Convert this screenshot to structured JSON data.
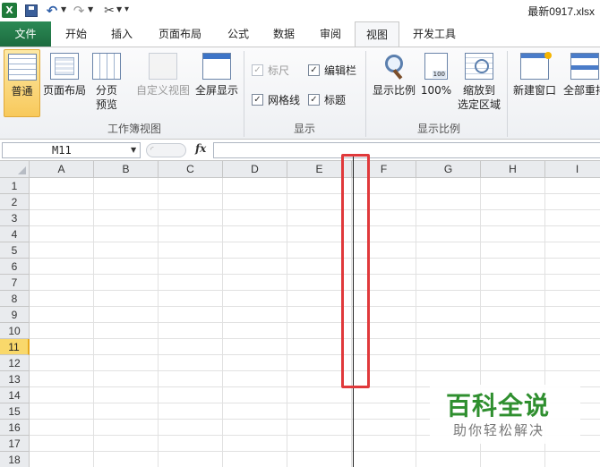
{
  "window": {
    "title": "最新0917.xlsx",
    "app_logo": "X"
  },
  "quick_access": {
    "icons": [
      "excel-logo-icon",
      "save-icon",
      "undo-icon",
      "redo-icon",
      "tools-icon"
    ]
  },
  "tabs": [
    {
      "label": "文件"
    },
    {
      "label": "开始"
    },
    {
      "label": "插入"
    },
    {
      "label": "页面布局"
    },
    {
      "label": "公式"
    },
    {
      "label": "数据"
    },
    {
      "label": "审阅"
    },
    {
      "label": "视图"
    },
    {
      "label": "开发工具"
    }
  ],
  "active_tab": "视图",
  "ribbon": {
    "workbook_views": {
      "label": "工作簿视图",
      "normal": "普通",
      "page_layout": "页面布局",
      "page_break_1": "分页",
      "page_break_2": "预览",
      "custom_views": "自定义视图",
      "full_screen": "全屏显示"
    },
    "show": {
      "label": "显示",
      "ruler": "标尺",
      "formula_bar": "编辑栏",
      "gridlines": "网格线",
      "headings": "标题"
    },
    "zoom": {
      "label": "显示比例",
      "zoom": "显示比例",
      "hundred": "100%",
      "hundred_icon_text": "100",
      "zoom_selection_1": "缩放到",
      "zoom_selection_2": "选定区域"
    },
    "window": {
      "new_window": "新建窗口",
      "arrange_all": "全部重排"
    }
  },
  "formula_bar": {
    "name_box": "M11",
    "fx": "fx",
    "value": ""
  },
  "grid": {
    "columns": [
      "A",
      "B",
      "C",
      "D",
      "E",
      "F",
      "G",
      "H",
      "I"
    ],
    "rows": [
      "1",
      "2",
      "3",
      "4",
      "5",
      "6",
      "7",
      "8",
      "9",
      "10",
      "11",
      "12",
      "13",
      "14",
      "15",
      "16",
      "17",
      "18"
    ],
    "active_row": "11"
  },
  "watermark": {
    "title": "百科全说",
    "subtitle": "助你轻松解决"
  },
  "colors": {
    "file_tab": "#217346",
    "highlight_box": "#e0393b",
    "active_row_header": "#f9d86b"
  }
}
